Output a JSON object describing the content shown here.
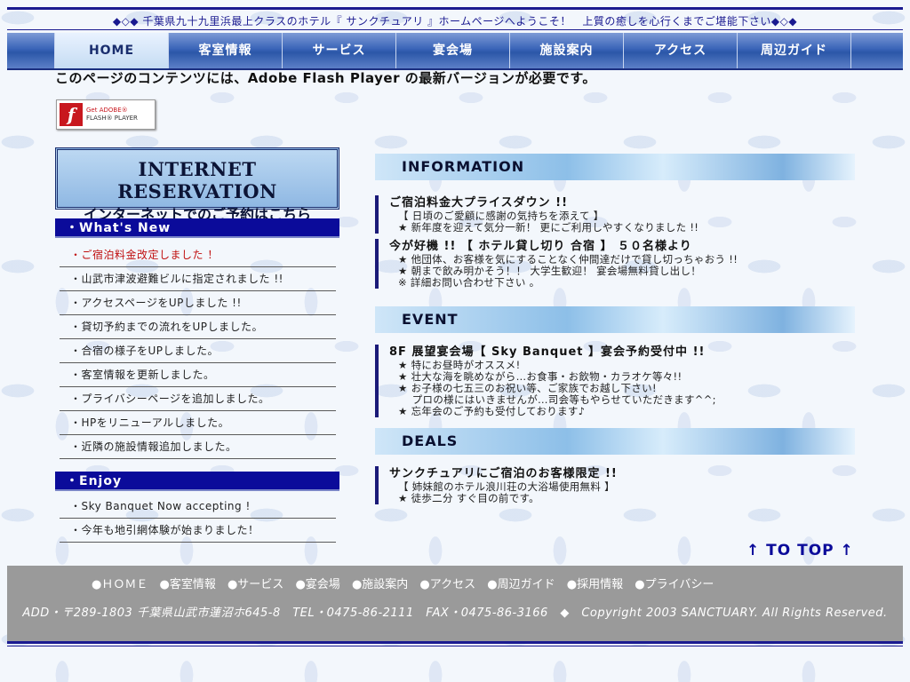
{
  "header": {
    "welcome": "◆◇◆ 千葉県九十九里浜最上クラスのホテル『 サンクチュアリ 』ホームページへようこそ！　上質の癒しを心行くまでご堪能下さい◆◇◆"
  },
  "nav": {
    "items": [
      "HOME",
      "客室情報",
      "サービス",
      "宴会場",
      "施設案内",
      "アクセス",
      "周辺ガイド"
    ]
  },
  "flash": {
    "note": "このページのコンテンツには、Adobe Flash Player の最新バージョンが必要です。",
    "badge_line1": "Get ADOBE®",
    "badge_line2": "FLASH® PLAYER",
    "logo_letter": "f"
  },
  "reservation": {
    "title_en": "INTERNET RESERVATION",
    "title_jp": "インターネットでのご予約はこちら"
  },
  "sidebar": {
    "whats_new_title": "・What's New",
    "whats_new": [
      "・ご宿泊料金改定しました ！",
      "・山武市津波避難ビルに指定されました !!",
      "・アクセスページをUPしました !!",
      "・貸切予約までの流れをUPしました。",
      "・合宿の様子をUPしました。",
      "・客室情報を更新しました。",
      "・プライバシーページを追加しました。",
      "・HPをリニューアルしました。",
      "・近隣の施設情報追加しました。"
    ],
    "enjoy_title": "・Enjoy",
    "enjoy": [
      "・Sky Banquet Now accepting !",
      "・今年も地引網体験が始まりました！"
    ]
  },
  "information": {
    "title": "INFORMATION",
    "entries": [
      {
        "title": "ご宿泊料金大プライスダウン !!",
        "lines": [
          "【 日頃のご愛顧に感謝の気持ちを添えて 】",
          "★ 新年度を迎えて気分一新！ 更にご利用しやすくなりました !!"
        ]
      },
      {
        "title": "今が好機 !! 【 ホテル貸し切り 合宿 】 ５０名様より",
        "lines": [
          "★ 他団体、お客様を気にすることなく仲間達だけで貸し切っちゃおう !!",
          "★ 朝まで飲み明かそう！！ 大学生歓迎！ 宴会場無料貸し出し！",
          "※ 詳細お問い合わせ下さい 。"
        ]
      }
    ]
  },
  "event": {
    "title": "EVENT",
    "entry": {
      "title": "8F 展望宴会場【 Sky Banquet 】宴会予約受付中 !!",
      "lines": [
        "★ 特にお昼時がオススメ!",
        "★ 壮大な海を眺めながら…お食事・お飲物・カラオケ等々!!",
        "★ お子様の七五三のお祝い等、ご家族でお越し下さい!",
        "　 プロの様にはいきませんが…司会等もやらせていただきます^^;",
        "★ 忘年会のご予約も受付しております♪"
      ]
    }
  },
  "deals": {
    "title": "DEALS",
    "entry": {
      "title": "サンクチュアリにご宿泊のお客様限定 !!",
      "lines": [
        "【 姉妹館のホテル浪川荘の大浴場使用無料 】",
        "★ 徒歩二分 すぐ目の前です。"
      ]
    }
  },
  "to_top": "↑ TO TOP ↑",
  "footer": {
    "links": [
      "●ＨＯＭＥ",
      "●客室情報",
      "●サービス",
      "●宴会場",
      "●施設案内",
      "●アクセス",
      "●周辺ガイド",
      "●採用情報",
      "●プライバシー"
    ],
    "address": "ADD・〒289-1803 千葉県山武市蓮沼ホ645-8　TEL・0475-86-2111　FAX・0475-86-3166　◆　Copyright 2003 SANCTUARY. All Rights Reserved."
  }
}
